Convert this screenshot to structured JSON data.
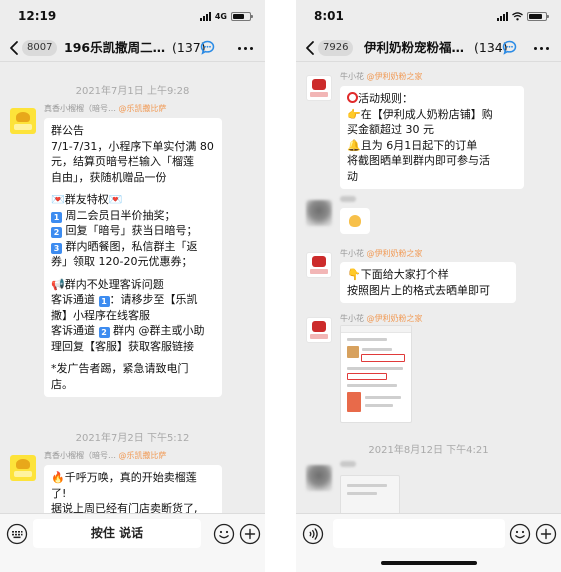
{
  "left_phone": {
    "status": {
      "time": "12:19",
      "network": "4G"
    },
    "nav": {
      "unread": "8007",
      "title": "196乐凯撒周二…",
      "members": "(137)"
    },
    "messages": [
      {
        "timestamp": "2021年7月1日 上午9:28"
      },
      {
        "sender_name": "真香小榴榴（暗号…",
        "sender_group": "@乐凯撒比萨",
        "lines": [
          "群公告",
          "7/1-7/31，小程序下单实付满 80",
          "元，结算页暗号栏输入「榴莲",
          "自由」，获随机赠品一份",
          "",
          "群友特权",
          "周二会员日半价抽奖；",
          "回复「暗号」获当日暗号；",
          "群内晒餐图，私信群主「返",
          "券」领取 120-20元优惠券；",
          "",
          "群内不处理客诉问题",
          "客诉通道",
          "：请移步至【乐凯",
          "撒】小程序在线客服",
          "客诉通道",
          "群内 @群主或小助",
          "理回复【客服】获取客服链接",
          "",
          "*发广告者踢，紧急请致电门",
          "店。"
        ]
      },
      {
        "timestamp": "2021年7月2日 下午5:12"
      },
      {
        "sender_name": "真香小榴榴（暗号…",
        "sender_group": "@乐凯撒比萨",
        "lines": [
          "千呼万唤，真的开始卖榴莲",
          "了!",
          "据说上周已经有门店卖断货了,"
        ]
      }
    ],
    "input": {
      "hold_to_talk": "按住 说话"
    }
  },
  "right_phone": {
    "status": {
      "time": "8:01"
    },
    "nav": {
      "unread": "7926",
      "title": "伊利奶粉宠粉福…",
      "members": "(134)"
    },
    "messages": [
      {
        "sender_name": "牛小花",
        "sender_group": "@伊利奶粉之家",
        "lines": [
          "活动规则：",
          "在【伊利成人奶粉店铺】购",
          "买金额超过 30 元",
          "且为 6月1日起下的订单",
          "将截图晒单到群内即可参与活",
          "动"
        ]
      },
      {
        "sender_name": "牛小花",
        "sender_group": "@伊利奶粉之家",
        "lines": [
          "下面给大家打个样",
          "按照图片上的格式去晒单即可"
        ]
      },
      {
        "sender_name": "牛小花",
        "sender_group": "@伊利奶粉之家"
      },
      {
        "timestamp": "2021年8月12日 下午4:21"
      }
    ]
  },
  "colors": {
    "chat_bg": "#ededed",
    "bubble": "#ffffff",
    "group_tag": "#f19a55",
    "timestamp": "#a9a9a9",
    "keycap": "#3d8cf0",
    "alert_red": "#e02a2a"
  },
  "icons": [
    "back-icon",
    "speech-bubble-icon",
    "more-icon",
    "keyboard-icon",
    "voice-icon",
    "emoji-icon",
    "plus-icon",
    "signal-icon",
    "wifi-icon",
    "battery-icon"
  ]
}
